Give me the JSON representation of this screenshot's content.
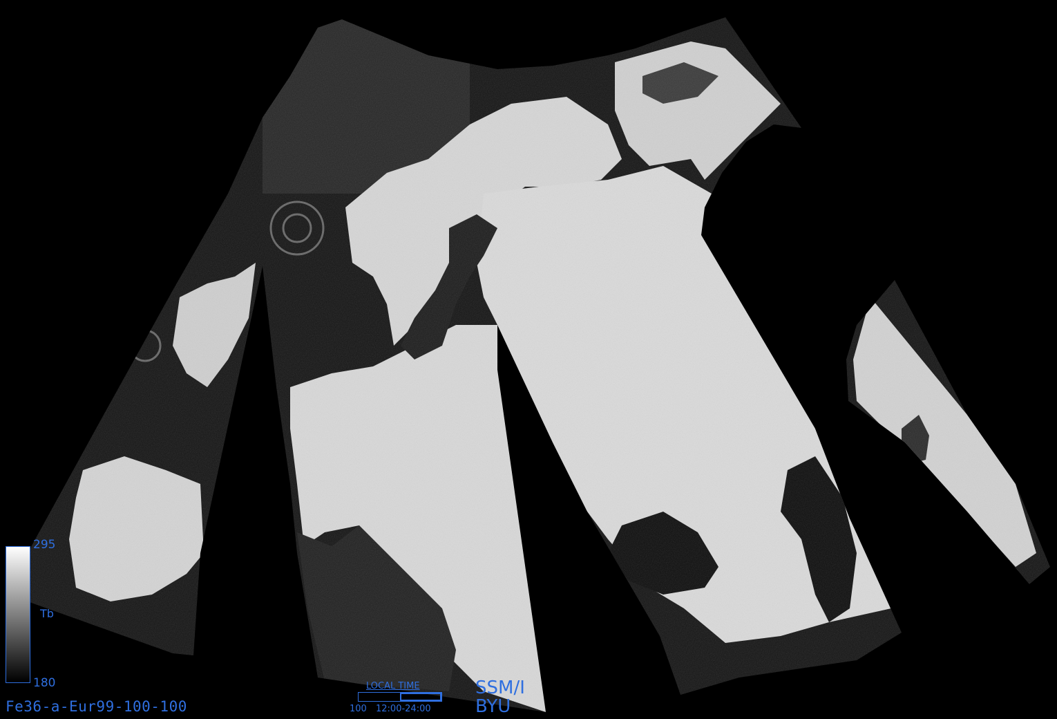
{
  "product_id": "Fe36-a-Eur99-100-100",
  "colorbar": {
    "max_label": "295",
    "min_label": "180",
    "variable_label": "Tb",
    "gradient_top": "#ffffff",
    "gradient_bottom": "#000000",
    "border_color": "#2f6fe0"
  },
  "local_time": {
    "title": "LOCAL  TIME",
    "days": "100",
    "range": "12:00-24:00",
    "indicator_fill_fraction": 0.5
  },
  "sensor": "SSM/I",
  "organization": "BYU",
  "colors": {
    "background": "#000000",
    "label": "#2f6fe0",
    "land": "#dcdcdc",
    "water": "#0a0a0a"
  }
}
